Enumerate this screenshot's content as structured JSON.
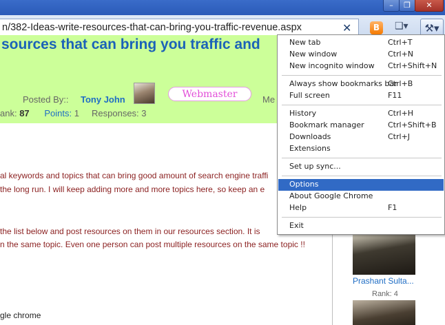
{
  "window": {
    "min_label": "–",
    "max_label": "❐",
    "close_label": "✕"
  },
  "toolbar": {
    "url": "n/382-Ideas-write-resources-that-can-bring-you-traffic-revenue.aspx",
    "clear_icon": "✕",
    "blogger_icon": "B",
    "page_icon": "❑▾",
    "wrench_icon": "⚒▾"
  },
  "page": {
    "title": "sources that can bring you traffic and",
    "posted_by_label": "Posted By::",
    "author": "Tony John",
    "badge": "Webmaster",
    "member_label": "Me",
    "stats": {
      "rank_label": "ank:",
      "rank_value": "87",
      "points_label": "Points:",
      "points_value": "1",
      "responses_label": "Responses:",
      "responses_value": "3"
    },
    "para1": [
      "al keywords and topics that can bring good amount of search engine traffi",
      " the long run. I will keep adding more and more topics here, so keep an e"
    ],
    "para2": [
      " the list below and post resources on them in our resources section. It is",
      "n the same topic. Even one person can post multiple resources on the same topic !!"
    ],
    "bottom_text": "gle chrome"
  },
  "sidebar": {
    "name": "Prashant Sulta...",
    "rank": "Rank: 4"
  },
  "menu": {
    "items": [
      {
        "label": "New tab",
        "shortcut": "Ctrl+T"
      },
      {
        "label": "New window",
        "shortcut": "Ctrl+N"
      },
      {
        "label": "New incognito window",
        "shortcut": "Ctrl+Shift+N"
      },
      {
        "label": "Always show bookmarks bar",
        "shortcut": "Ctrl+B"
      },
      {
        "label": "Full screen",
        "shortcut": "F11"
      },
      {
        "label": "History",
        "shortcut": "Ctrl+H"
      },
      {
        "label": "Bookmark manager",
        "shortcut": "Ctrl+Shift+B"
      },
      {
        "label": "Downloads",
        "shortcut": "Ctrl+J"
      },
      {
        "label": "Extensions",
        "shortcut": ""
      },
      {
        "label": "Set up sync...",
        "shortcut": ""
      },
      {
        "label": "Options",
        "shortcut": ""
      },
      {
        "label": "About Google Chrome",
        "shortcut": ""
      },
      {
        "label": "Help",
        "shortcut": "F1"
      },
      {
        "label": "Exit",
        "shortcut": ""
      }
    ]
  },
  "colors": {
    "banner": "#ccff99",
    "link": "#1f6dc4",
    "menu_highlight": "#316ac5",
    "badge_text": "#e24fd8"
  }
}
